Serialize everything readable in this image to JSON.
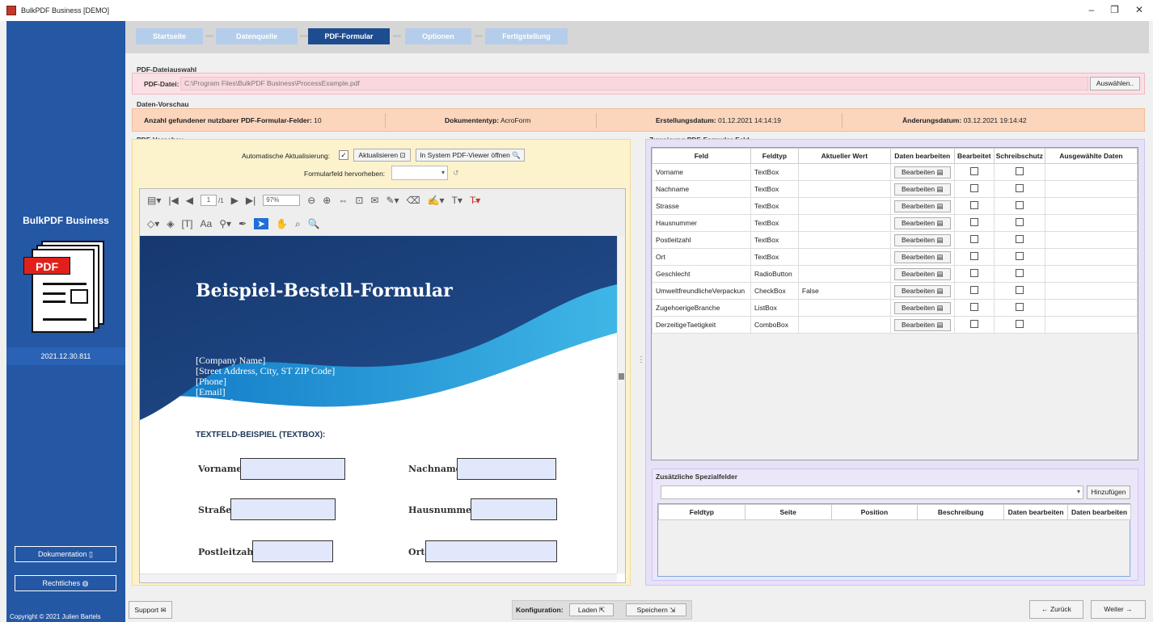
{
  "window": {
    "title": "BulkPDF Business [DEMO]",
    "min": "–",
    "max": "❐",
    "close": "✕"
  },
  "sidebar": {
    "brand": "BulkPDF Business",
    "logo_text": "PDF",
    "version": "2021.12.30.811",
    "doc_button": "Dokumentation",
    "legal_button": "Rechtliches",
    "copyright": "Copyright © 2021 Julien Bartels"
  },
  "steps": [
    {
      "label": "Startseite",
      "active": false
    },
    {
      "label": "Datenquelle",
      "active": false
    },
    {
      "label": "PDF-Formular",
      "active": true
    },
    {
      "label": "Optionen",
      "active": false
    },
    {
      "label": "Fertigstellung",
      "active": false
    }
  ],
  "pdf_file": {
    "section": "PDF-Dateiauswahl",
    "label": "PDF-Datei:",
    "path": "C:\\Program Files\\BulkPDF Business\\ProcessExample.pdf",
    "select_button": "Auswählen.."
  },
  "data_preview": {
    "section": "Daten-Vorschau",
    "field_count_label": "Anzahl gefundener nutzbarer PDF-Formular-Felder:",
    "field_count": "10",
    "doctype_label": "Dokumententyp:",
    "doctype": "AcroForm",
    "created_label": "Erstellungsdatum:",
    "created": "01.12.2021 14:14:19",
    "modified_label": "Änderungsdatum:",
    "modified": "03.12.2021 19:14:42"
  },
  "pdf_preview": {
    "section": "PDF-Vorschau",
    "auto_update_label": "Automatische Aktualisierung:",
    "auto_update_check": "✓",
    "refresh_button": "Aktualisieren",
    "open_viewer_button": "In System PDF-Viewer öffnen",
    "highlight_label": "Formularfeld hervorheben:",
    "page_current": "1",
    "page_total": "/1",
    "zoom": "97%"
  },
  "pdf_document": {
    "title": "Beispiel-Bestell-Formular",
    "address": [
      "[Company Name]",
      "[Street Address, City, ST ZIP Code]",
      "[Phone]",
      "[Email]",
      "[Website]"
    ],
    "section_heading": "TEXTFELD-BEISPIEL (TEXTBOX):",
    "labels": {
      "vorname": "Vorname:",
      "nachname": "Nachname:",
      "strasse": "Straße:",
      "hausnummer": "Hausnummer:",
      "postleitzahl": "Postleitzahl:",
      "ort": "Ort:"
    }
  },
  "assignment": {
    "section": "Zuweisung PDF-Formular-Feld",
    "columns": [
      "Feld",
      "Feldtyp",
      "Aktueller Wert",
      "Daten bearbeiten",
      "Bearbeitet",
      "Schreibschutz",
      "Ausgewählte Daten"
    ],
    "edit_label": "Bearbeiten",
    "rows": [
      {
        "feld": "Vorname",
        "typ": "TextBox",
        "wert": ""
      },
      {
        "feld": "Nachname",
        "typ": "TextBox",
        "wert": ""
      },
      {
        "feld": "Strasse",
        "typ": "TextBox",
        "wert": ""
      },
      {
        "feld": "Hausnummer",
        "typ": "TextBox",
        "wert": ""
      },
      {
        "feld": "Postleitzahl",
        "typ": "TextBox",
        "wert": ""
      },
      {
        "feld": "Ort",
        "typ": "TextBox",
        "wert": ""
      },
      {
        "feld": "Geschlecht",
        "typ": "RadioButton",
        "wert": ""
      },
      {
        "feld": "UmweltfreundlicheVerpackun",
        "typ": "CheckBox",
        "wert": "False"
      },
      {
        "feld": "ZugehoerigeBranche",
        "typ": "ListBox",
        "wert": ""
      },
      {
        "feld": "DerzeitigeTaetigkeit",
        "typ": "ComboBox",
        "wert": ""
      }
    ]
  },
  "special": {
    "section": "Zusätzliche Spezialfelder",
    "add_button": "Hinzufügen",
    "columns": [
      "Feldtyp",
      "Seite",
      "Position",
      "Beschreibung",
      "Daten bearbeiten",
      "Daten bearbeiten"
    ]
  },
  "footer": {
    "support": "Support",
    "config_label": "Konfiguration:",
    "load": "Laden",
    "save": "Speichern",
    "back": "← Zurück",
    "next": "Weiter →"
  }
}
